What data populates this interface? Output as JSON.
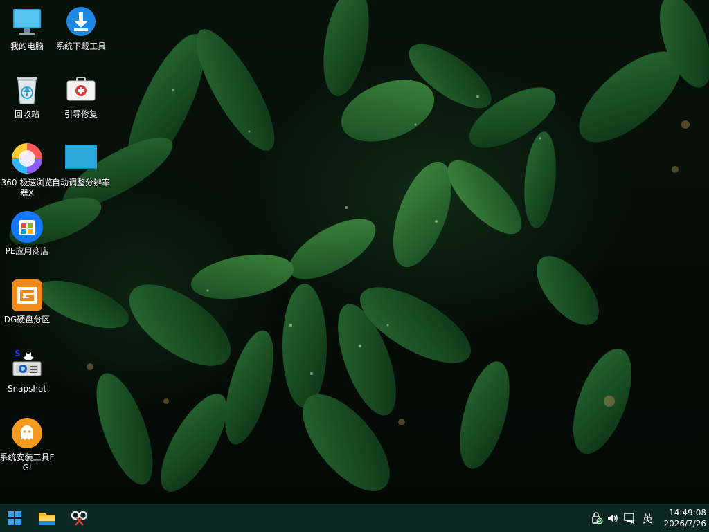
{
  "desktop": {
    "icons": [
      {
        "label": "我的电脑",
        "icon": "computer-icon"
      },
      {
        "label": "系统下载工具",
        "icon": "download-icon"
      },
      {
        "label": "回收站",
        "icon": "recycle-bin-icon"
      },
      {
        "label": "引导修复",
        "icon": "repair-kit-icon"
      },
      {
        "label": "360 极速浏览器X",
        "icon": "browser-360-icon"
      },
      {
        "label": "自动调整分辨率",
        "icon": "display-icon"
      },
      {
        "label": "PE应用商店",
        "icon": "store-icon"
      },
      {
        "label": "DG硬盘分区",
        "icon": "diskgenius-icon"
      },
      {
        "label": "Snapshot",
        "icon": "snapshot-icon"
      },
      {
        "label": "系统安装工具FGI",
        "icon": "ghost-installer-icon"
      }
    ]
  },
  "taskbar": {
    "start": "windows-start-icon",
    "pinned": [
      "file-explorer-icon",
      "snipping-tool-icon"
    ],
    "tray": {
      "ime_label": "英",
      "time": "14:49:08",
      "date": "2026/7/26"
    }
  },
  "colors": {
    "taskbar_bg": "#0c2a26",
    "download_blue": "#1e88e5",
    "dg_orange": "#f08a1c",
    "fgi_orange": "#f39a1f",
    "store_blue": "#1677ff"
  }
}
